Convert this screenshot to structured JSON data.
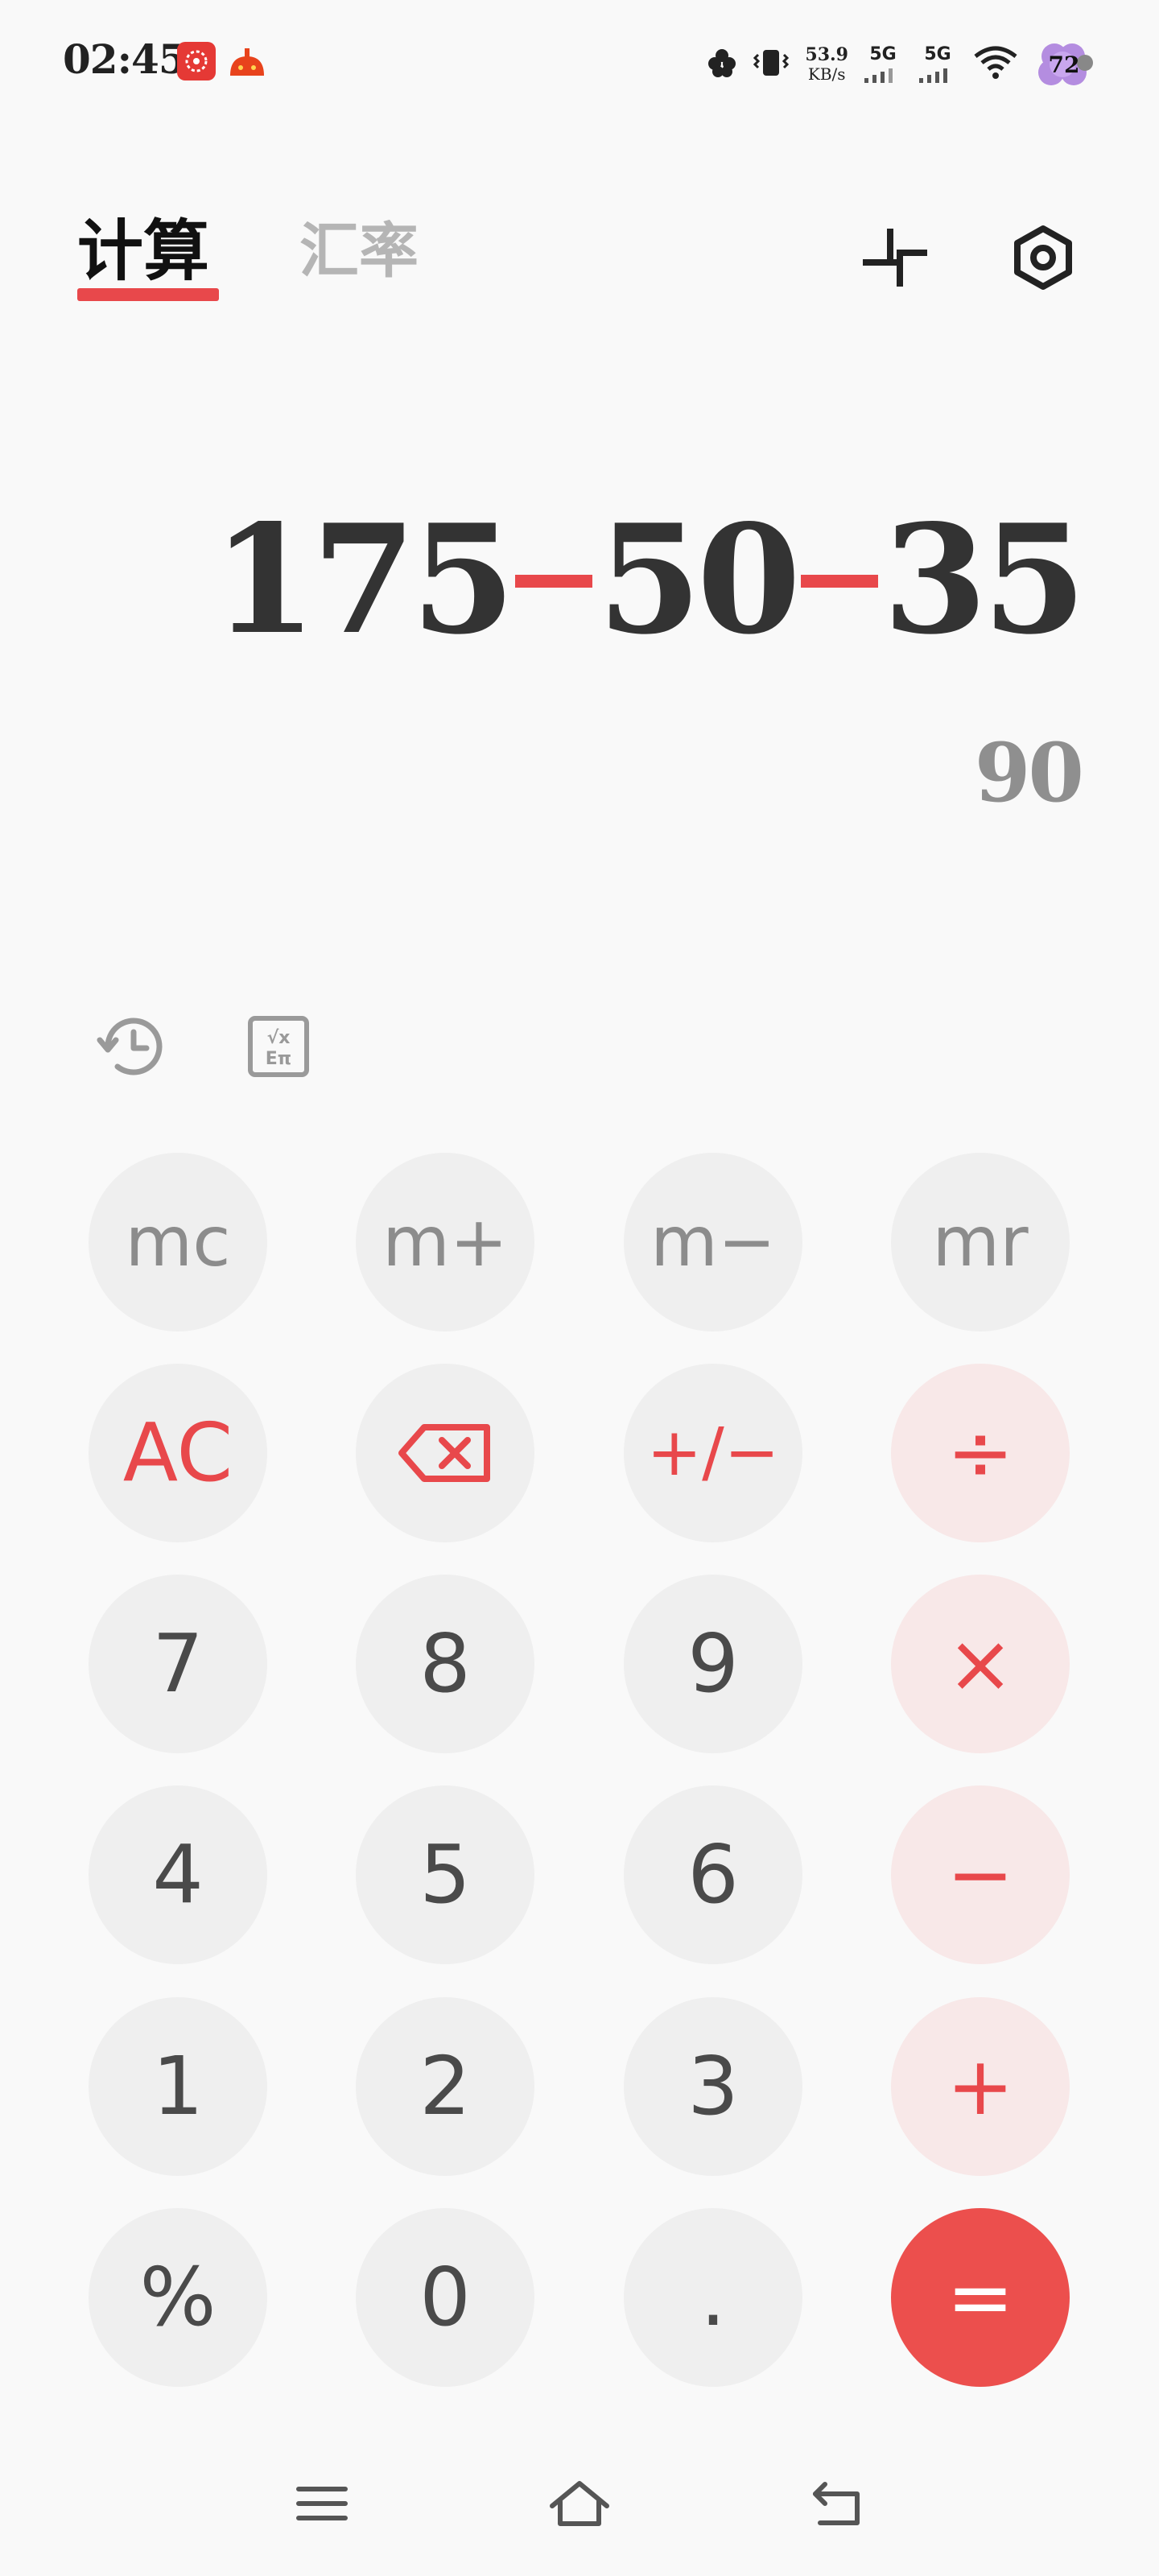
{
  "status_bar": {
    "time": "02:45",
    "net_speed_value": "53.9",
    "net_speed_unit": "KB/s",
    "signal_1": "5G",
    "signal_2": "5G",
    "battery_level": "72"
  },
  "tabs": [
    {
      "label": "计算",
      "active": true
    },
    {
      "label": "汇率",
      "active": false
    }
  ],
  "display": {
    "expr_part_1": "175",
    "expr_part_2": "50",
    "expr_part_3": "35",
    "result": "90"
  },
  "keys": {
    "mc": "mc",
    "m_plus": "m+",
    "m_minus": "m−",
    "mr": "mr",
    "ac": "AC",
    "plus_minus": "+/−",
    "divide": "÷",
    "seven": "7",
    "eight": "8",
    "nine": "9",
    "multiply": "×",
    "four": "4",
    "five": "5",
    "six": "6",
    "minus": "−",
    "one": "1",
    "two": "2",
    "three": "3",
    "plus": "+",
    "percent": "%",
    "zero": "0",
    "decimal": ".",
    "equals": "="
  },
  "icons": {
    "shrink": "shrink-icon",
    "settings": "settings-icon",
    "history": "history-icon",
    "scientific": "scientific-icon",
    "backspace": "backspace-icon",
    "menu": "menu-icon",
    "home": "home-icon",
    "back": "back-icon"
  },
  "colors": {
    "accent": "#e8484b",
    "key_bg": "#efefef",
    "op_key_bg": "#f8e8e8",
    "equals_bg": "#ec4f4d",
    "background": "#f9f9f9"
  }
}
